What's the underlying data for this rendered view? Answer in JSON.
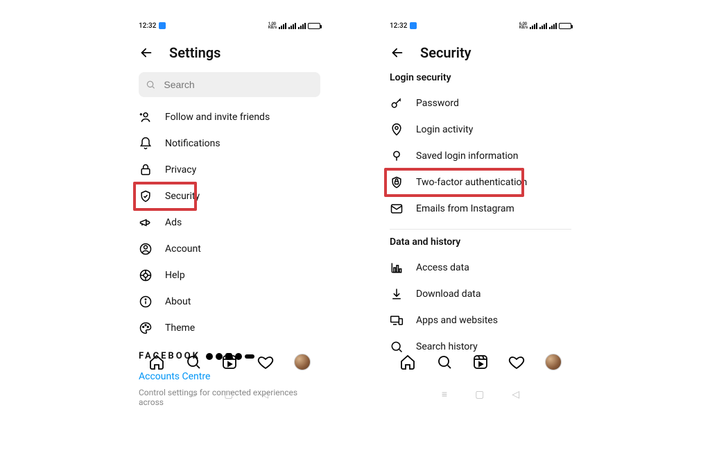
{
  "status": {
    "time": "12:32"
  },
  "left": {
    "title": "Settings",
    "search_placeholder": "Search",
    "items": [
      {
        "label": "Follow and invite friends"
      },
      {
        "label": "Notifications"
      },
      {
        "label": "Privacy"
      },
      {
        "label": "Security"
      },
      {
        "label": "Ads"
      },
      {
        "label": "Account"
      },
      {
        "label": "Help"
      },
      {
        "label": "About"
      },
      {
        "label": "Theme"
      }
    ],
    "brand": "FACEBOOK",
    "accounts_link": "Accounts Centre",
    "accounts_sub": "Control settings for connected experiences across"
  },
  "right": {
    "title": "Security",
    "section1": "Login security",
    "section2": "Data and history",
    "login_items": [
      {
        "label": "Password"
      },
      {
        "label": "Login activity"
      },
      {
        "label": "Saved login information"
      },
      {
        "label": "Two-factor authentication"
      },
      {
        "label": "Emails from Instagram"
      }
    ],
    "data_items": [
      {
        "label": "Access data"
      },
      {
        "label": "Download data"
      },
      {
        "label": "Apps and websites"
      },
      {
        "label": "Search history"
      }
    ]
  }
}
